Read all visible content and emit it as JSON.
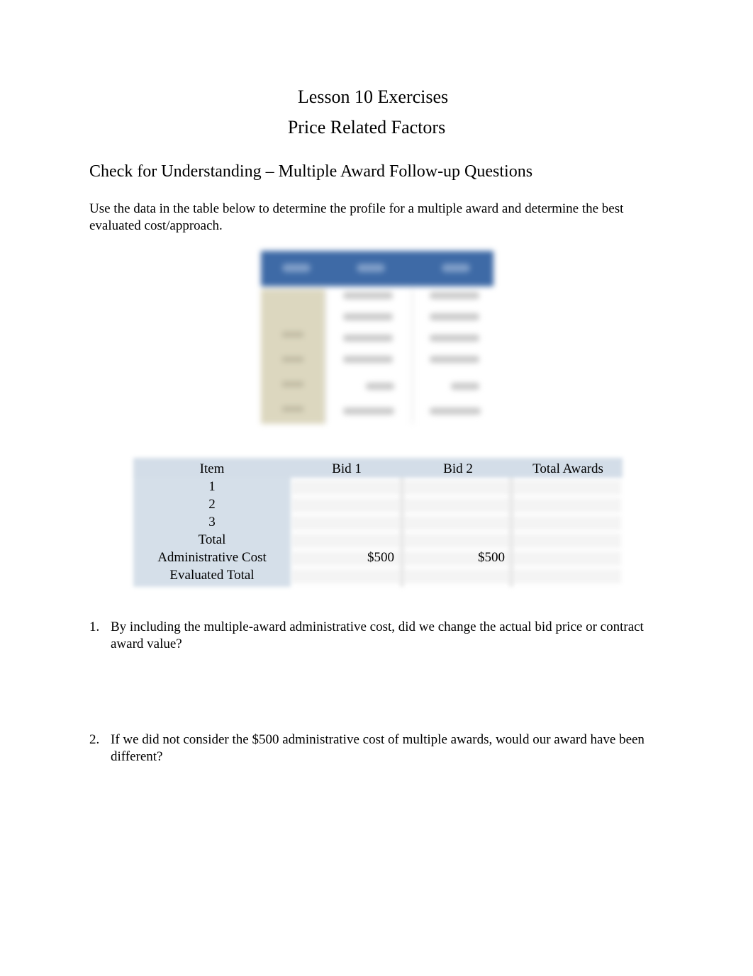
{
  "document": {
    "title": "Lesson 10 Exercises",
    "subtitle": "Price Related Factors",
    "section_heading": "Check for Understanding – Multiple Award Follow-up Questions",
    "instructions": "Use the data in the table below to determine the profile for a multiple award and determine the best evaluated cost/approach."
  },
  "colors": {
    "blurred_header": "#3e6aa6",
    "blurred_label_column": "#dcd7bf",
    "table_label_column": "#d5dfe9"
  },
  "blurred_table": {
    "note": "illegible blurred image of bid data table (header row + 6 data rows, 3 columns)"
  },
  "award_table": {
    "headers": [
      "Item",
      "Bid 1",
      "Bid 2",
      "Total Awards"
    ],
    "rows": [
      [
        "1",
        "",
        "",
        ""
      ],
      [
        "2",
        "",
        "",
        ""
      ],
      [
        "3",
        "",
        "",
        ""
      ],
      [
        "Total",
        "",
        "",
        ""
      ],
      [
        "Administrative Cost",
        "$500",
        "$500",
        ""
      ],
      [
        "Evaluated Total",
        "",
        "",
        ""
      ]
    ]
  },
  "questions": [
    {
      "number": "1.",
      "text": "By including the multiple-award administrative cost, did we change the actual bid price or contract award value?"
    },
    {
      "number": "2.",
      "text": "If we did not consider the $500 administrative cost of multiple awards, would our award have been different?"
    }
  ]
}
